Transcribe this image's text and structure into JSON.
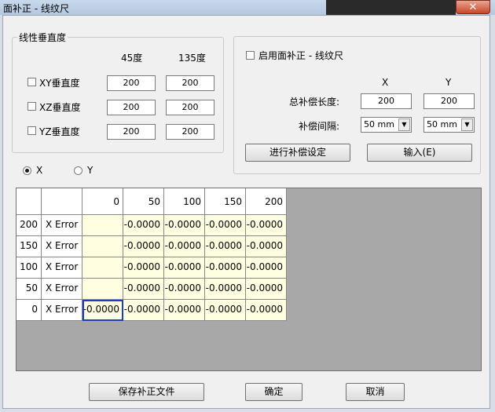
{
  "window": {
    "title": "面补正 - 线纹尺",
    "close": "✕"
  },
  "left_group": {
    "legend": "线性垂直度",
    "col_45": "45度",
    "col_135": "135度",
    "rows": [
      {
        "label": "XY垂直度",
        "v45": "200",
        "v135": "200"
      },
      {
        "label": "XZ垂直度",
        "v45": "200",
        "v135": "200"
      },
      {
        "label": "YZ垂直度",
        "v45": "200",
        "v135": "200"
      }
    ]
  },
  "right_group": {
    "enable_label": "启用面补正 - 线纹尺",
    "col_x": "X",
    "col_y": "Y",
    "total_len_label": "总补偿长度:",
    "total_len_x": "200",
    "total_len_y": "200",
    "interval_label": "补偿间隔:",
    "interval_x": "50 mm",
    "interval_y": "50 mm",
    "setup_button": "进行补偿设定",
    "input_button": "输入(E)"
  },
  "axis_radio": {
    "x": "X",
    "y": "Y",
    "selected": "X"
  },
  "grid": {
    "col_headers": [
      "0",
      "50",
      "100",
      "150",
      "200"
    ],
    "rows": [
      {
        "pos": "200",
        "label": "X Error",
        "values": [
          "",
          "-0.0000",
          "-0.0000",
          "-0.0000",
          "-0.0000"
        ]
      },
      {
        "pos": "150",
        "label": "X Error",
        "values": [
          "",
          "-0.0000",
          "-0.0000",
          "-0.0000",
          "-0.0000"
        ]
      },
      {
        "pos": "100",
        "label": "X Error",
        "values": [
          "",
          "-0.0000",
          "-0.0000",
          "-0.0000",
          "-0.0000"
        ]
      },
      {
        "pos": "50",
        "label": "X Error",
        "values": [
          "",
          "-0.0000",
          "-0.0000",
          "-0.0000",
          "-0.0000"
        ]
      },
      {
        "pos": "0",
        "label": "X Error",
        "values": [
          "-0.0000",
          "-0.0000",
          "-0.0000",
          "-0.0000",
          "-0.0000"
        ]
      }
    ]
  },
  "footer": {
    "save": "保存补正文件",
    "ok": "确定",
    "cancel": "取消"
  }
}
